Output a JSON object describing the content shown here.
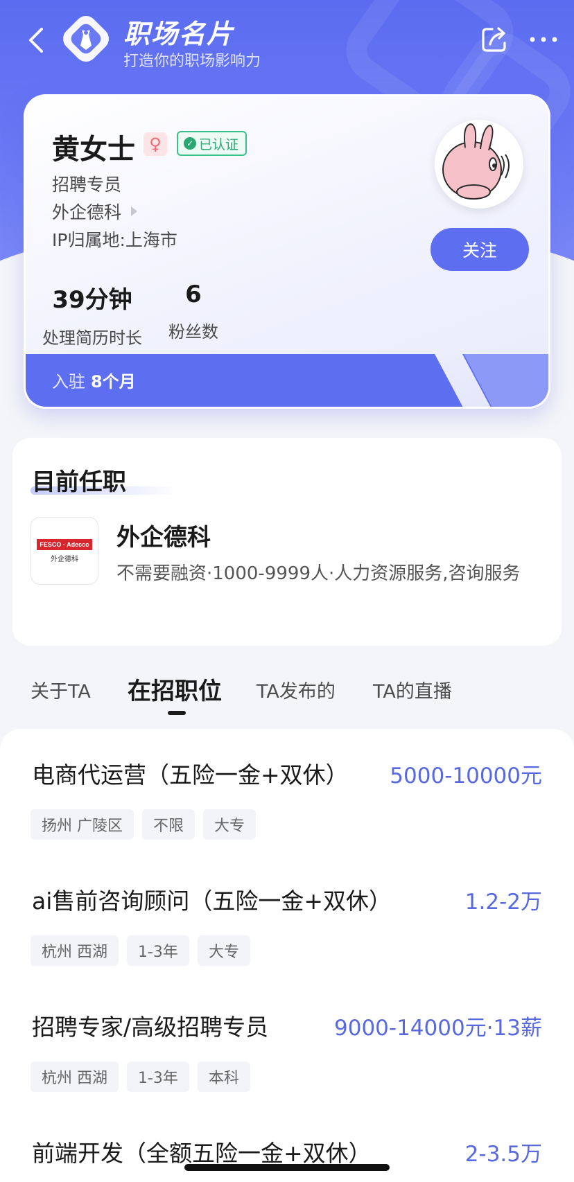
{
  "header": {
    "title": "职场名片",
    "subtitle": "打造你的职场影响力"
  },
  "profile": {
    "name": "黄女士",
    "gender_symbol": "♀",
    "verified_label": "已认证",
    "role": "招聘专员",
    "company": "外企德科",
    "ip_location": "IP归属地:上海市",
    "follow_label": "关注",
    "stats": [
      {
        "value": "39分钟",
        "label": "处理简历时长"
      },
      {
        "value": "6",
        "label": "粉丝数"
      }
    ],
    "tenure_prefix": "入驻",
    "tenure_value": "8个月"
  },
  "current_job": {
    "section_title": "目前任职",
    "company_name": "外企德科",
    "company_desc": "不需要融资·1000-9999人·人力资源服务,咨询服务",
    "logo_text_en": "FESCO · Adecco",
    "logo_text_cn": "外企德科"
  },
  "tabs": [
    {
      "label": "关于TA",
      "active": false
    },
    {
      "label": "在招职位",
      "active": true
    },
    {
      "label": "TA发布的",
      "active": false
    },
    {
      "label": "TA的直播",
      "active": false
    }
  ],
  "jobs": [
    {
      "title": "电商代运营（五险一金+双休）",
      "salary": "5000-10000元",
      "tags": [
        "扬州 广陵区",
        "不限",
        "大专"
      ]
    },
    {
      "title": "ai售前咨询顾问（五险一金+双休）",
      "salary": "1.2-2万",
      "tags": [
        "杭州 西湖",
        "1-3年",
        "大专"
      ]
    },
    {
      "title": "招聘专家/高级招聘专员",
      "salary": "9000-14000元·13薪",
      "tags": [
        "杭州 西湖",
        "1-3年",
        "本科"
      ]
    },
    {
      "title": "前端开发（全额五险一金+双休）",
      "salary": "2-3.5万",
      "tags": []
    }
  ],
  "colors": {
    "brand": "#5d6ff0",
    "salary": "#5869e0",
    "verified": "#2aa874",
    "gender": "#f06a7a"
  },
  "icons": [
    "back-arrow-icon",
    "briefcase-shield-icon",
    "share-icon",
    "more-icon",
    "check-icon",
    "triangle-right-icon"
  ]
}
